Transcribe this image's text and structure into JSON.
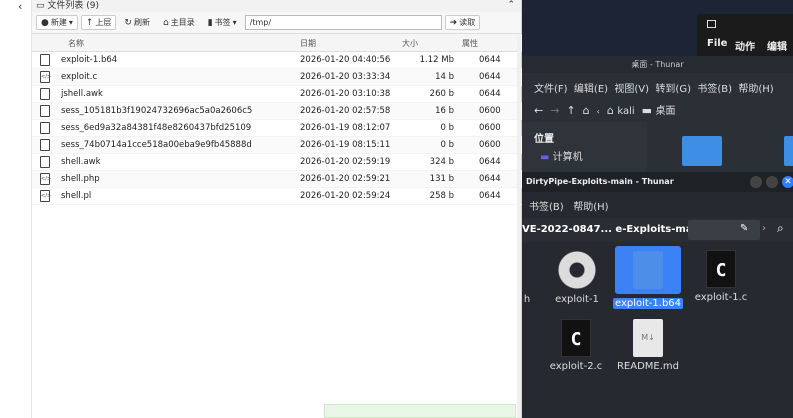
{
  "file_manager": {
    "title": "文件列表 (9)",
    "toolbar": {
      "new": "新建",
      "up": "上层",
      "refresh": "刷新",
      "home": "主目录",
      "bookmarks": "书签",
      "path": "/tmp/",
      "go": "读取"
    },
    "columns": {
      "name": "名称",
      "date": "日期",
      "size": "大小",
      "attr": "属性"
    },
    "files": [
      {
        "name": "exploit-1.b64",
        "date": "2026-01-20 04:40:56",
        "size": "1.12 Mb",
        "attr": "0644",
        "icon": "file-icon"
      },
      {
        "name": "exploit.c",
        "date": "2026-01-20 03:33:34",
        "size": "14 b",
        "attr": "0644",
        "icon": "code-file-icon"
      },
      {
        "name": "jshell.awk",
        "date": "2026-01-20 03:10:38",
        "size": "260 b",
        "attr": "0644",
        "icon": "file-icon"
      },
      {
        "name": "sess_105181b3f19024732696ac5a0a2606c5",
        "date": "2026-01-20 02:57:58",
        "size": "16 b",
        "attr": "0600",
        "icon": "file-icon"
      },
      {
        "name": "sess_6ed9a32a84381f48e8260437bfd25109",
        "date": "2026-01-19 08:12:07",
        "size": "0 b",
        "attr": "0600",
        "icon": "file-icon"
      },
      {
        "name": "sess_74b0714a1cce518a00eba9e9fb45888d",
        "date": "2026-01-19 08:15:11",
        "size": "0 b",
        "attr": "0600",
        "icon": "file-icon"
      },
      {
        "name": "shell.awk",
        "date": "2026-01-20 02:59:19",
        "size": "324 b",
        "attr": "0644",
        "icon": "file-icon"
      },
      {
        "name": "shell.php",
        "date": "2026-01-20 02:59:21",
        "size": "131 b",
        "attr": "0644",
        "icon": "code-file-icon"
      },
      {
        "name": "shell.pl",
        "date": "2026-01-20 02:59:24",
        "size": "258 b",
        "attr": "0644",
        "icon": "code-file-icon"
      }
    ]
  },
  "terminal": {
    "menu": [
      "File",
      "动作",
      "编辑"
    ]
  },
  "thunar_desktop": {
    "title": "桌面 - Thunar",
    "menu": [
      "文件(F)",
      "编辑(E)",
      "视图(V)",
      "转到(G)",
      "书签(B)",
      "帮助(H)"
    ],
    "nav_location": "kali",
    "nav_folder": "桌面",
    "places_header": "位置",
    "computer": "计算机"
  },
  "thunar_exploit": {
    "title": "DirtyPipe-Exploits-main - Thunar",
    "menu": [
      "书签(B)",
      "帮助(H)"
    ],
    "breadcrumb": "VE-2022-0847... e-Exploits-main",
    "items": [
      {
        "label": "h",
        "icon": "gear-icon"
      },
      {
        "label": "exploit-1",
        "icon": "gear-icon"
      },
      {
        "label": "exploit-1.b64",
        "icon": "document-icon"
      },
      {
        "label": "exploit-1.c",
        "icon": "c-file-icon"
      },
      {
        "label": "exploit-2.c",
        "icon": "c-file-icon"
      },
      {
        "label": "README.md",
        "icon": "markdown-file-icon"
      }
    ]
  },
  "colors": {
    "accent": "#3b82f6",
    "desktop_bg": "#1d2436",
    "toast": "#e9f5e6"
  }
}
